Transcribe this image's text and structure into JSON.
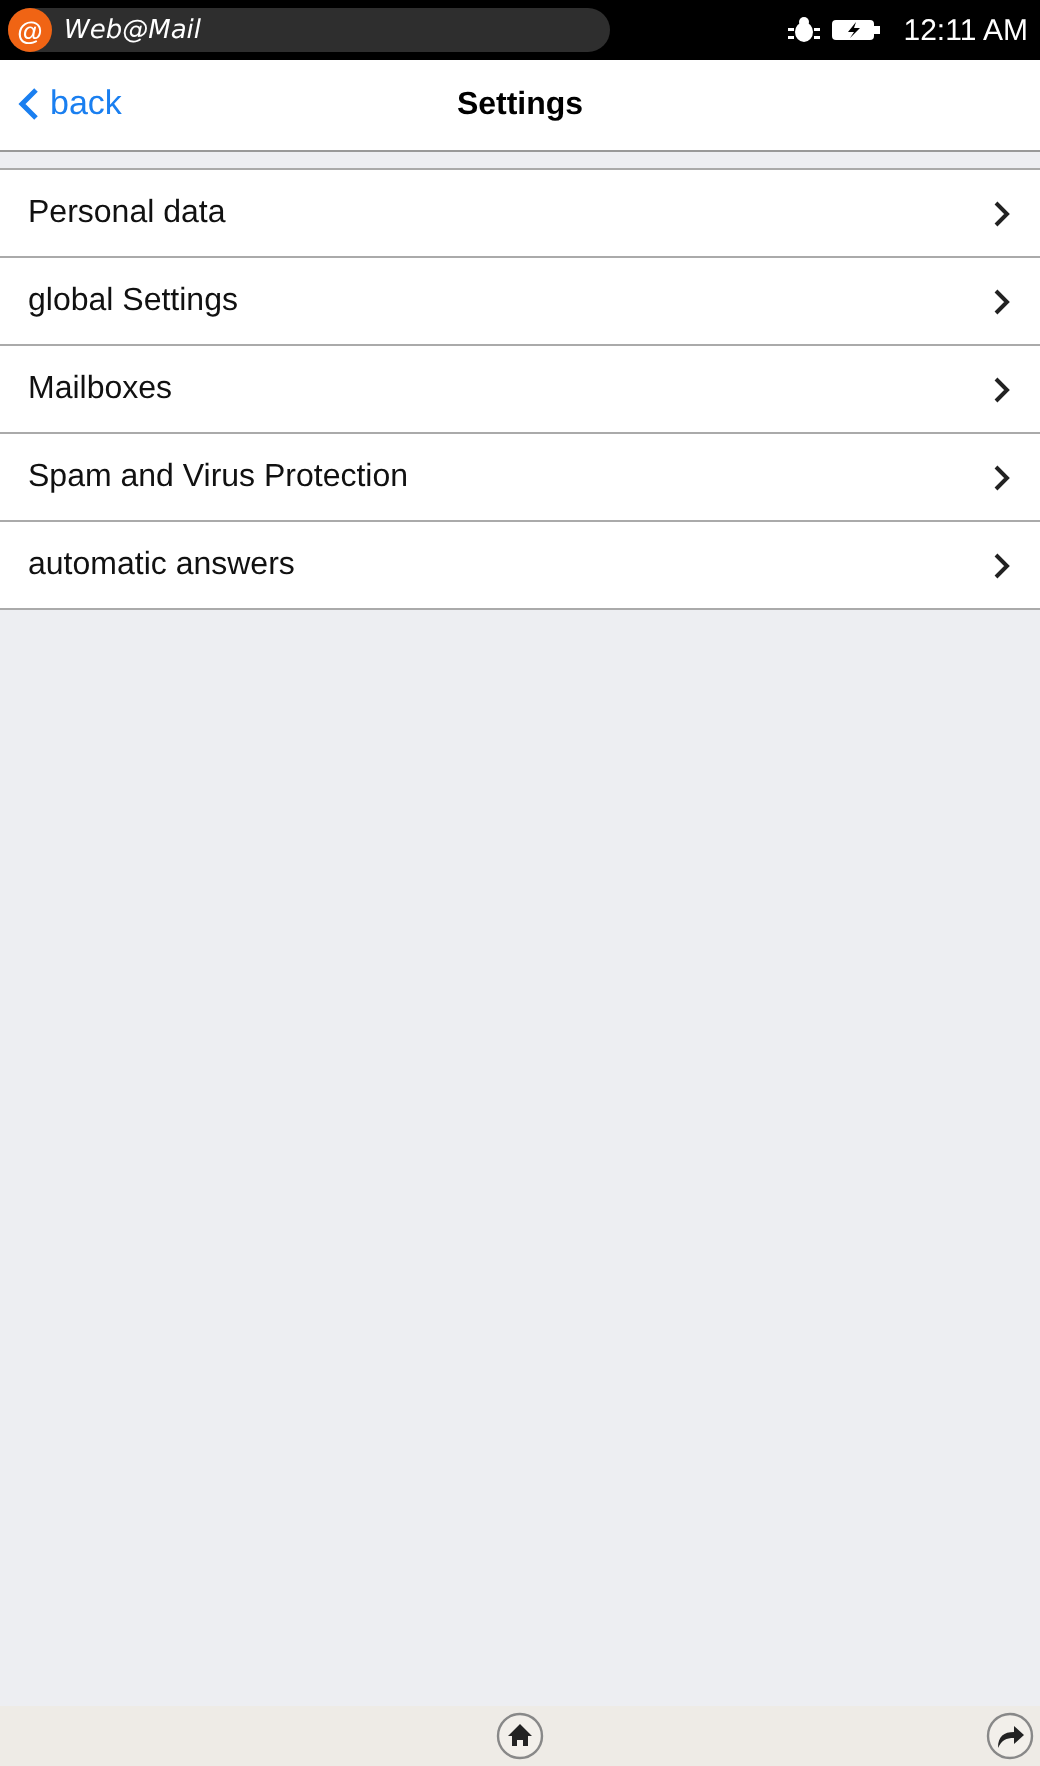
{
  "status_bar": {
    "app_glyph": "@",
    "app_title": "Web@Mail",
    "time": "12:11 AM"
  },
  "header": {
    "back": "back",
    "title": "Settings"
  },
  "items": [
    {
      "label": "Personal data"
    },
    {
      "label": "global Settings"
    },
    {
      "label": "Mailboxes"
    },
    {
      "label": "Spam and Virus Protection"
    },
    {
      "label": "automatic answers"
    }
  ]
}
